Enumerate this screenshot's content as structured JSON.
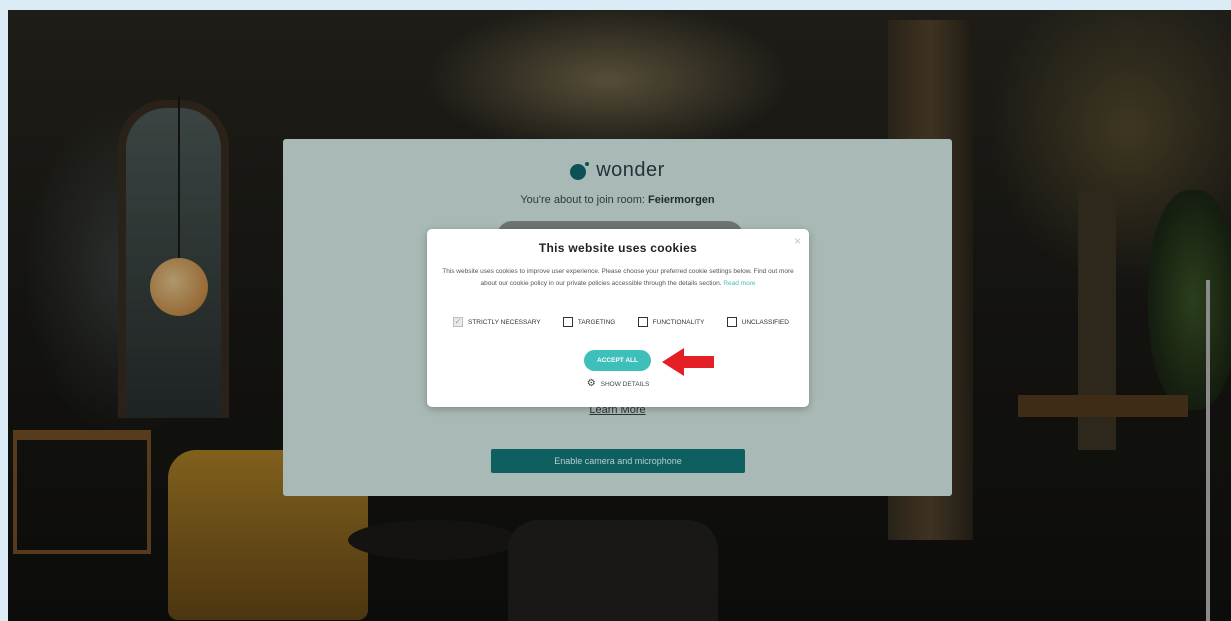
{
  "brand": {
    "name": "wonder"
  },
  "join": {
    "text": "You're about to join room: ",
    "room": "Feiermorgen",
    "learn_more": "Learn More",
    "enable_button": "Enable camera and microphone"
  },
  "cookie": {
    "title": "This website uses cookies",
    "close": "×",
    "body": "This website uses cookies to improve user experience. Please choose your preferred cookie settings below. Find out more about our cookie policy in our private policies accessible through the details section.",
    "read_more": "Read more",
    "options": [
      {
        "label": "STRICTLY NECESSARY",
        "checked": true
      },
      {
        "label": "TARGETING",
        "checked": false
      },
      {
        "label": "FUNCTIONALITY",
        "checked": false
      },
      {
        "label": "UNCLASSIFIED",
        "checked": false
      }
    ],
    "check_mark": "✓",
    "accept_all": "ACCEPT ALL",
    "show_details": "SHOW DETAILS"
  },
  "colors": {
    "accent": "#3fbfb9",
    "enable_button": "#0d5f60",
    "arrow": "#e31e24",
    "page_border": "#dcecf6"
  },
  "icons": [
    "wonder-logo-icon",
    "close-icon",
    "checkbox-icon",
    "gear-icon",
    "red-arrow-icon"
  ]
}
